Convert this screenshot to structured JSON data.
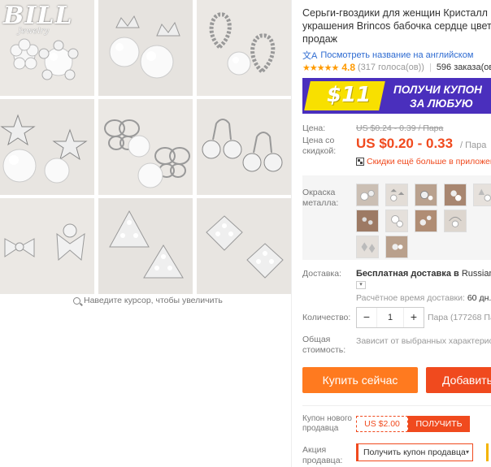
{
  "gallery": {
    "brand": "BILL",
    "brand_sub": "Jewelry",
    "zoom_hint": "Наведите курсор, чтобы увеличить",
    "tiles": [
      "flower-pearl-earrings",
      "crown-pearl-earrings",
      "drop-pearl-earrings",
      "star-pearl-earrings",
      "butterfly-pearl-earrings",
      "cherry-crystal-earrings",
      "bow-crystal-earrings",
      "triangle-crystal-earrings",
      "rhombus-crystal-earrings"
    ]
  },
  "product": {
    "title_lines": [
      "Серьги-гвоздики для женщин Кристалл И",
      "украшения Brincos бабочка сердце цвето",
      "продаж"
    ],
    "translate_link": "Посмотреть название на английском",
    "stars": "★★★★★",
    "rating": "4.8",
    "votes": "(317 голоса(ов))",
    "separator": "|",
    "orders": "596 заказа(ов"
  },
  "banner": {
    "amount": "$11",
    "line1": "ПОЛУЧИ КУПОН",
    "line2": "ЗА ЛЮБУЮ"
  },
  "price": {
    "label": "Цена:",
    "old": "US $0.24 - 0.39 / Пара",
    "discount_label": "Цена со скидкой:",
    "new": "US $0.20 - 0.33",
    "unit": "/ Пара",
    "app_deal": "Скидки ещё больше в приложени"
  },
  "options": {
    "color_label": "Окраска металла:",
    "swatch_count": 11
  },
  "shipping": {
    "label": "Доставка:",
    "title": "Бесплатная доставка в",
    "country": "Russian Fed",
    "time_label": "Расчётное время доставки:",
    "time_value": "60 дн."
  },
  "quantity": {
    "label": "Количество:",
    "minus": "−",
    "value": "1",
    "plus": "+",
    "available": "Пара (177268 Пар"
  },
  "total": {
    "label": "Общая стоимость:",
    "note": "Зависит от выбранных характеристи"
  },
  "actions": {
    "buy": "Купить сейчас",
    "cart": "Добавить"
  },
  "coupon": {
    "label": "Купон нового продавца",
    "value": "US $2.00",
    "get": "ПОЛУЧИТЬ"
  },
  "promo": {
    "label": "Акция продавца:",
    "select": "Получить купон продавца",
    "caret": "▾"
  },
  "colors": {
    "price": "#f04a1e",
    "buy": "#ff7a1f",
    "cart": "#f04a1e",
    "banner_bg": "#4a2fbd",
    "banner_coupon": "#f8e000",
    "stars": "#ff9a00",
    "link": "#2e6bd1"
  }
}
